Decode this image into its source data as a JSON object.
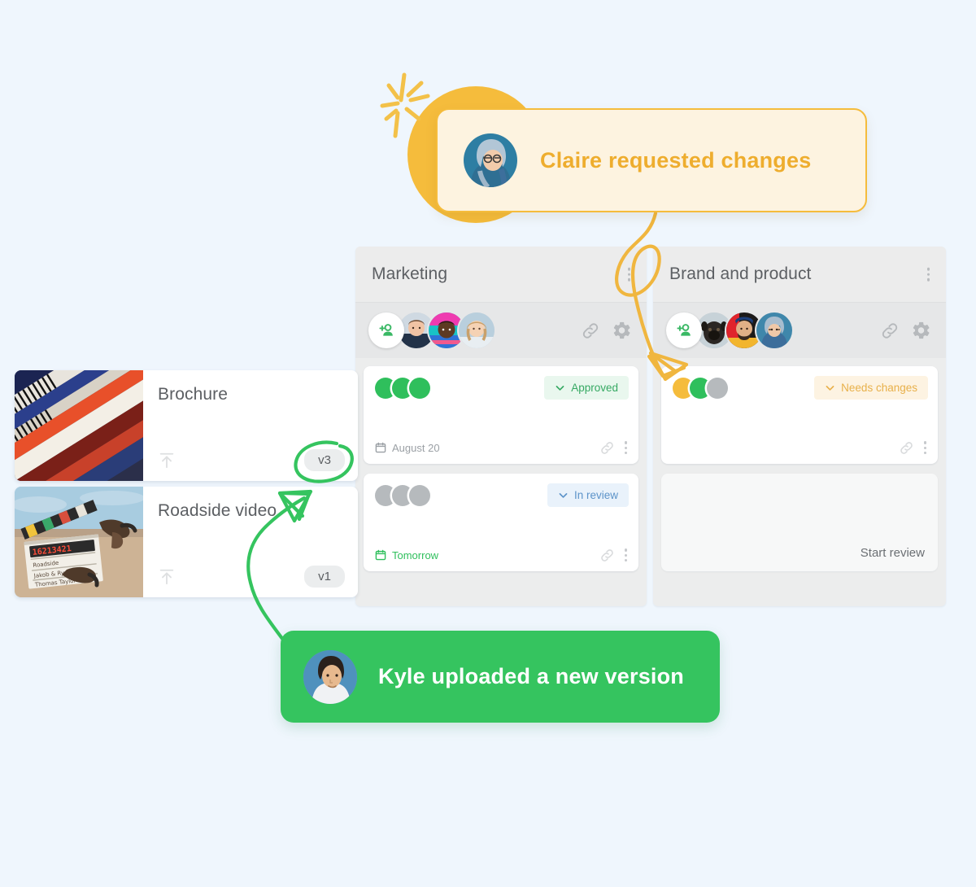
{
  "page": {
    "background_color": "#eff6fd"
  },
  "toasts": [
    {
      "id": "claire",
      "text": "Claire requested changes",
      "accent_color": "#f5bc3c",
      "text_color": "#eead2e",
      "background_color": "#fdf3e0",
      "avatar_name": "claire-avatar"
    },
    {
      "id": "kyle",
      "text": "Kyle uploaded a new version",
      "accent_color": "#35c45f",
      "text_color": "#ffffff",
      "background_color": "#35c45f",
      "avatar_name": "kyle-avatar"
    }
  ],
  "files": [
    {
      "name": "Brochure",
      "version": "v3",
      "thumbnail": "magazine-stack-photo",
      "upload_icon": "upload-icon"
    },
    {
      "name": "Roadside video",
      "version": "v1",
      "thumbnail": "clapperboard-photo",
      "upload_icon": "upload-icon"
    }
  ],
  "columns": [
    {
      "title": "Marketing",
      "menu_icon": "kebab-menu-icon",
      "add_member_icon": "add-person-icon",
      "member_count": 3,
      "tools": [
        "link-icon",
        "gear-icon"
      ],
      "cards": [
        {
          "status_label": "Approved",
          "status_type": "approved",
          "status_bg": "#e9f7ee",
          "status_fg": "#36a963",
          "dots": [
            "#2fbf5c",
            "#2fbf5c",
            "#2fbf5c"
          ],
          "due_label": "August 20",
          "due_soon": false,
          "calendar_icon": "calendar-icon",
          "link_icon": "link-icon",
          "menu_icon": "kebab-menu-icon"
        },
        {
          "status_label": "In review",
          "status_type": "in-review",
          "status_bg": "#e9f2fb",
          "status_fg": "#5c93c9",
          "dots": [
            "#b6babd",
            "#b6babd",
            "#b6babd"
          ],
          "due_label": "Tomorrow",
          "due_soon": true,
          "calendar_icon": "calendar-icon",
          "link_icon": "link-icon",
          "menu_icon": "kebab-menu-icon"
        }
      ]
    },
    {
      "title": "Brand and product",
      "menu_icon": "kebab-menu-icon",
      "add_member_icon": "add-person-icon",
      "member_count": 3,
      "tools": [
        "link-icon",
        "gear-icon"
      ],
      "cards": [
        {
          "status_label": "Needs changes",
          "status_type": "needs-changes",
          "status_bg": "#fdf3e2",
          "status_fg": "#e8b04a",
          "dots": [
            "#f5bc3c",
            "#2fbf5c",
            "#b6babd"
          ],
          "due_label": "",
          "due_soon": false,
          "link_icon": "link-icon",
          "menu_icon": "kebab-menu-icon"
        },
        {
          "status_label": "",
          "status_type": "empty",
          "dots": [],
          "action_label": "Start review"
        }
      ]
    }
  ],
  "annotations": [
    {
      "name": "yellow-arrow",
      "color": "#f0b63f",
      "from": "claire-toast",
      "to": "needs-changes-card"
    },
    {
      "name": "green-arrow",
      "color": "#35c45f",
      "from": "kyle-toast",
      "to": "brochure-version-badge"
    },
    {
      "name": "green-circle-highlight",
      "color": "#35c45f",
      "target": "brochure-version-badge"
    },
    {
      "name": "sparkle-icon",
      "color": "#f3c149"
    }
  ]
}
